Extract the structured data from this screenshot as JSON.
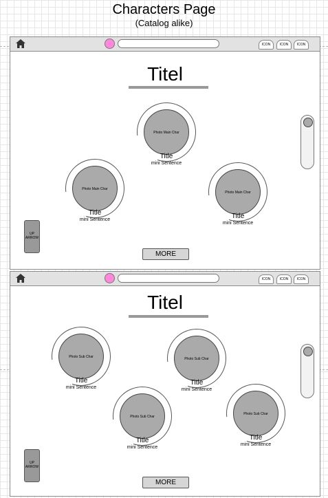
{
  "page_title": "Characters Page",
  "page_subtitle": "(Catalog alike)",
  "colors": {
    "accent_dot": "#ff88dd",
    "photo_fill": "#aaaaaa",
    "topbar": "#e2e2e2"
  },
  "frames": [
    {
      "topbar": {
        "home_icon": "home-icon",
        "icons": [
          "ICON",
          "ICON",
          "ICON"
        ]
      },
      "title": "Titel",
      "cards": [
        {
          "photo_label": "Photo Main Char",
          "title": "Title",
          "subtitle": "mini Sentence"
        },
        {
          "photo_label": "Photo Main Char",
          "title": "Title",
          "subtitle": "mini Sentence"
        },
        {
          "photo_label": "Photo Main Char",
          "title": "Title",
          "subtitle": "mini Sentence"
        }
      ],
      "up_arrow": "UP ARROW",
      "more": "MORE"
    },
    {
      "topbar": {
        "home_icon": "home-icon",
        "icons": [
          "ICON",
          "ICON",
          "ICON"
        ]
      },
      "title": "Titel",
      "cards": [
        {
          "photo_label": "Photo Sub Char",
          "title": "Title",
          "subtitle": "mini Sentence"
        },
        {
          "photo_label": "Photo Sub Char",
          "title": "Title",
          "subtitle": "mini Sentence"
        },
        {
          "photo_label": "Photo Sub Char",
          "title": "Title",
          "subtitle": "mini Sentence"
        },
        {
          "photo_label": "Photo Sub Char",
          "title": "Title",
          "subtitle": "mini Sentence"
        }
      ],
      "up_arrow": "UP ARROW",
      "more": "MORE"
    }
  ]
}
